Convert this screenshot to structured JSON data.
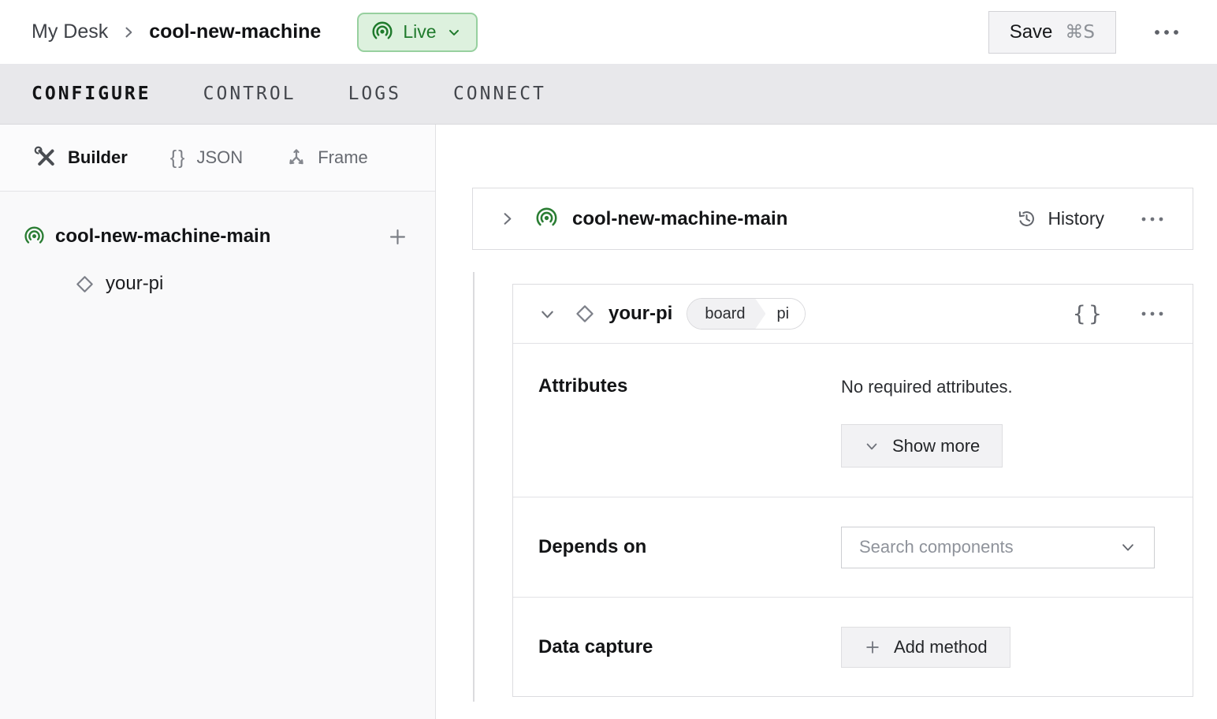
{
  "topbar": {
    "breadcrumb": {
      "parent": "My Desk",
      "current": "cool-new-machine"
    },
    "live": {
      "label": "Live"
    },
    "save": {
      "label": "Save",
      "shortcut": "⌘S"
    }
  },
  "tabs": [
    "CONFIGURE",
    "CONTROL",
    "LOGS",
    "CONNECT"
  ],
  "sidebar": {
    "views": [
      "Builder",
      "JSON",
      "Frame"
    ],
    "tree": {
      "root": "cool-new-machine-main",
      "child": "your-pi"
    }
  },
  "main": {
    "machine_card": {
      "title": "cool-new-machine-main",
      "history_label": "History"
    },
    "component_card": {
      "title": "your-pi",
      "badge": {
        "type": "board",
        "model": "pi"
      },
      "attributes": {
        "label": "Attributes",
        "empty_text": "No required attributes.",
        "show_more_label": "Show more"
      },
      "depends_on": {
        "label": "Depends on",
        "placeholder": "Search components"
      },
      "data_capture": {
        "label": "Data capture",
        "add_method_label": "Add method"
      }
    }
  },
  "icons": {
    "braces": "{}"
  },
  "colors": {
    "accent_green": "#2a7d33",
    "live_bg": "#ddf1de",
    "live_border": "#97d09f",
    "live_text": "#1f7a2c"
  }
}
